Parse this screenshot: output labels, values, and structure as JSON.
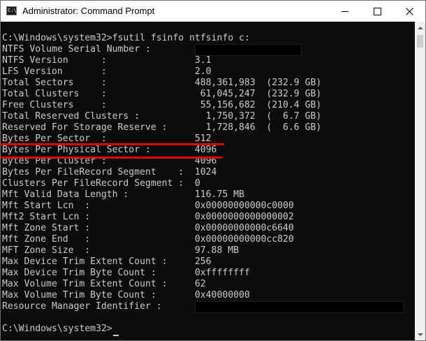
{
  "window": {
    "title": "Administrator: Command Prompt",
    "icon": "cmd-icon",
    "icon_glyph": "C:\\"
  },
  "console": {
    "command_line": "C:\\Windows\\system32>fsutil fsinfo ntfsinfo c:",
    "output_lines": [
      "NTFS Volume Serial Number :",
      "NTFS Version      :                3.1",
      "LFS Version       :                2.0",
      "Total Sectors     :                488,361,983  (232.9 GB)",
      "Total Clusters    :                 61,045,247  (232.9 GB)",
      "Free Clusters     :                 55,156,682  (210.4 GB)",
      "Total Reserved Clusters :            1,750,372  (  6.7 GB)",
      "Reserved For Storage Reserve :       1,728,846  (  6.6 GB)",
      "Bytes Per Sector  :                512",
      "Bytes Per Physical Sector :        4096",
      "Bytes Per Cluster :                4096",
      "Bytes Per FileRecord Segment    :  1024",
      "Clusters Per FileRecord Segment :  0",
      "Mft Valid Data Length :            116.75 MB",
      "Mft Start Lcn  :                   0x00000000000c0000",
      "Mft2 Start Lcn :                   0x0000000000000002",
      "Mft Zone Start :                   0x00000000000c6640",
      "Mft Zone End   :                   0x00000000000cc820",
      "MFT Zone Size  :                   97.88 MB",
      "Max Device Trim Extent Count :     256",
      "Max Device Trim Byte Count :       0xffffffff",
      "Max Volume Trim Extent Count :     62",
      "Max Volume Trim Byte Count :       0x40000000",
      "Resource Manager Identifier :"
    ],
    "prompt_line": "C:\\Windows\\system32>"
  },
  "colors": {
    "console_background": "#0c0c0c",
    "console_text": "#cccccc",
    "annotation_underline": "#e30000",
    "titlebar_background": "#ffffff"
  },
  "icons": {
    "minimize": "minimize-icon",
    "maximize": "maximize-icon",
    "close": "close-icon",
    "scroll_up": "scroll-up-arrow-icon",
    "scroll_down": "scroll-down-arrow-icon"
  }
}
